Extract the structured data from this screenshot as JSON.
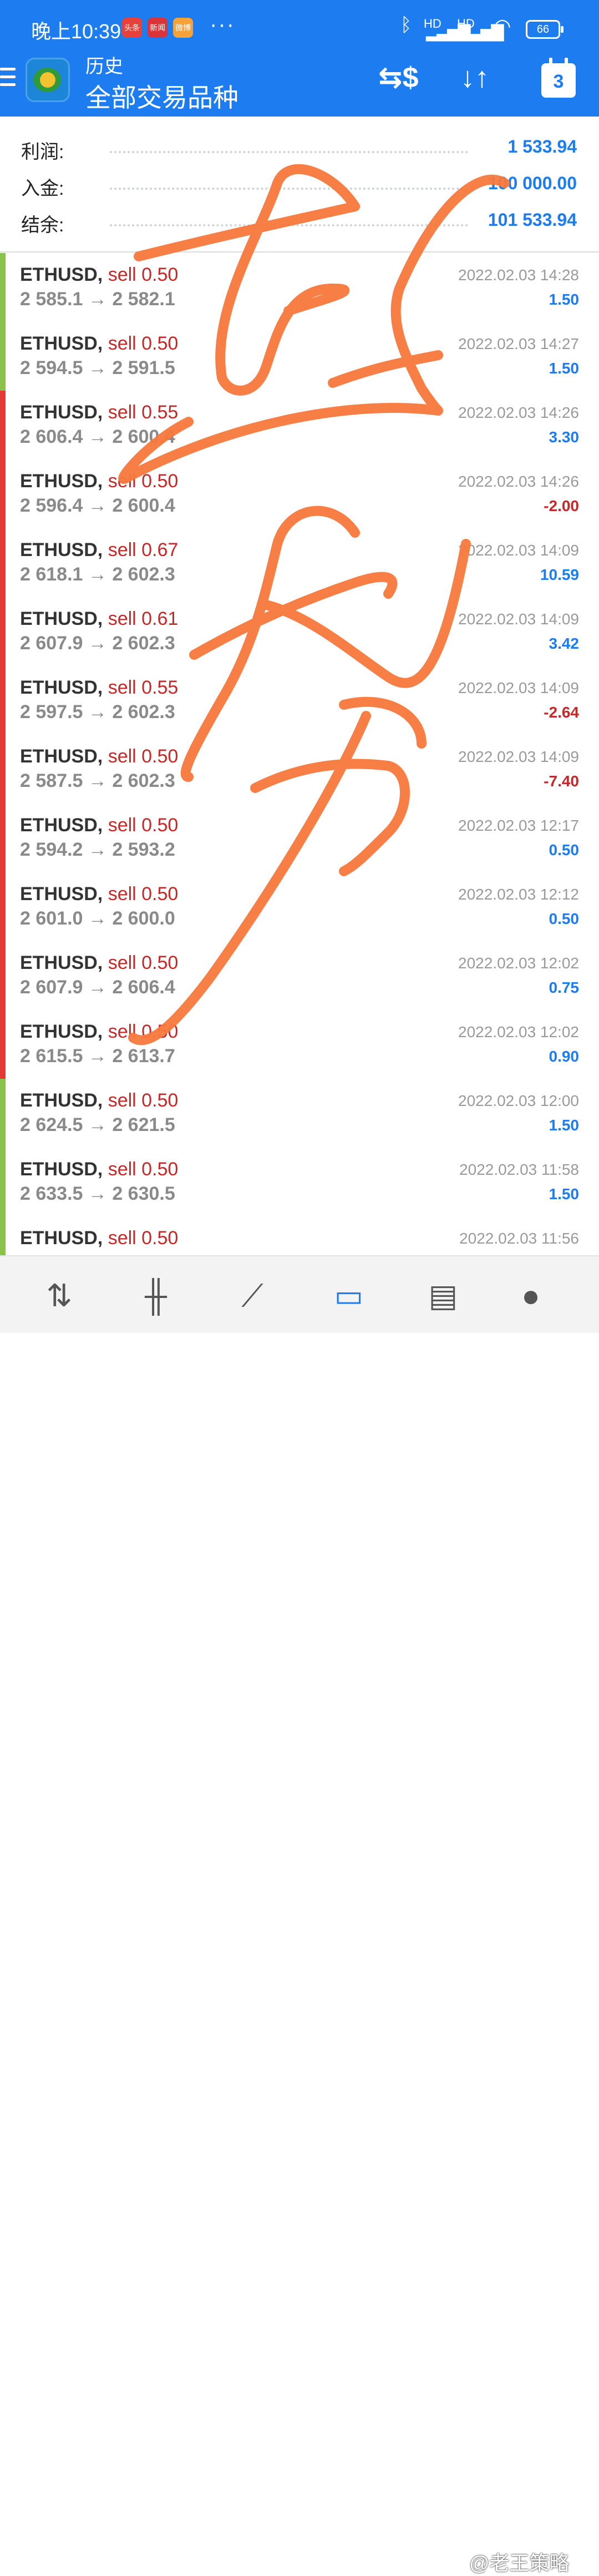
{
  "status_bar": {
    "time": "晚上10:39",
    "app_icons": [
      "头条",
      "新闻",
      "微博"
    ],
    "more": "···",
    "network_1": "HD",
    "network_2": "HD",
    "battery": "66"
  },
  "header": {
    "title": "历史",
    "subtitle": "全部交易品种",
    "calendar_day": "3",
    "icons": [
      "menu-icon",
      "app-logo-icon",
      "currency-swap-icon",
      "sort-icon",
      "calendar-icon"
    ]
  },
  "summary": {
    "profit_label": "利润:",
    "profit_value": "1 533.94",
    "deposit_label": "入金:",
    "deposit_value": "100 000.00",
    "balance_label": "结余:",
    "balance_value": "101 533.94"
  },
  "trades": [
    {
      "symbol": "ETHUSD,",
      "side": "sell 0.50",
      "prices": "2 585.1 → 2 582.1",
      "date": "2022.02.03 14:28",
      "pl": "1.50",
      "bar_color": "#8bc34a"
    },
    {
      "symbol": "ETHUSD,",
      "side": "sell 0.50",
      "prices": "2 594.5 → 2 591.5",
      "date": "2022.02.03 14:27",
      "pl": "1.50",
      "bar_color": "#8bc34a"
    },
    {
      "symbol": "ETHUSD,",
      "side": "sell 0.55",
      "prices": "2 606.4 → 2 600.4",
      "date": "2022.02.03 14:26",
      "pl": "3.30",
      "bar_color": "#e53935"
    },
    {
      "symbol": "ETHUSD,",
      "side": "sell 0.50",
      "prices": "2 596.4 → 2 600.4",
      "date": "2022.02.03 14:26",
      "pl": "-2.00",
      "bar_color": "#e53935"
    },
    {
      "symbol": "ETHUSD,",
      "side": "sell 0.67",
      "prices": "2 618.1 → 2 602.3",
      "date": "2022.02.03 14:09",
      "pl": "10.59",
      "bar_color": "#e53935"
    },
    {
      "symbol": "ETHUSD,",
      "side": "sell 0.61",
      "prices": "2 607.9 → 2 602.3",
      "date": "2022.02.03 14:09",
      "pl": "3.42",
      "bar_color": "#e53935"
    },
    {
      "symbol": "ETHUSD,",
      "side": "sell 0.55",
      "prices": "2 597.5 → 2 602.3",
      "date": "2022.02.03 14:09",
      "pl": "-2.64",
      "bar_color": "#e53935"
    },
    {
      "symbol": "ETHUSD,",
      "side": "sell 0.50",
      "prices": "2 587.5 → 2 602.3",
      "date": "2022.02.03 14:09",
      "pl": "-7.40",
      "bar_color": "#e53935"
    },
    {
      "symbol": "ETHUSD,",
      "side": "sell 0.50",
      "prices": "2 594.2 → 2 593.2",
      "date": "2022.02.03 12:17",
      "pl": "0.50",
      "bar_color": "#e53935"
    },
    {
      "symbol": "ETHUSD,",
      "side": "sell 0.50",
      "prices": "2 601.0 → 2 600.0",
      "date": "2022.02.03 12:12",
      "pl": "0.50",
      "bar_color": "#e53935"
    },
    {
      "symbol": "ETHUSD,",
      "side": "sell 0.50",
      "prices": "2 607.9 → 2 606.4",
      "date": "2022.02.03 12:02",
      "pl": "0.75",
      "bar_color": "#e53935"
    },
    {
      "symbol": "ETHUSD,",
      "side": "sell 0.50",
      "prices": "2 615.5 → 2 613.7",
      "date": "2022.02.03 12:02",
      "pl": "0.90",
      "bar_color": "#e53935"
    },
    {
      "symbol": "ETHUSD,",
      "side": "sell 0.50",
      "prices": "2 624.5 → 2 621.5",
      "date": "2022.02.03 12:00",
      "pl": "1.50",
      "bar_color": "#8bc34a"
    },
    {
      "symbol": "ETHUSD,",
      "side": "sell 0.50",
      "prices": "2 633.5 → 2 630.5",
      "date": "2022.02.03 11:58",
      "pl": "1.50",
      "bar_color": "#8bc34a"
    },
    {
      "symbol": "ETHUSD,",
      "side": "sell 0.50",
      "prices": "",
      "date": "2022.02.03 11:56",
      "pl": "",
      "bar_color": "#8bc34a"
    }
  ],
  "bottom_nav": {
    "items": [
      {
        "icon": "quotes-icon",
        "active": false
      },
      {
        "icon": "chart-icon",
        "active": false
      },
      {
        "icon": "trade-icon",
        "active": false
      },
      {
        "icon": "history-icon",
        "active": true
      },
      {
        "icon": "news-icon",
        "active": false
      },
      {
        "icon": "chat-icon",
        "active": false
      }
    ]
  },
  "watermark": "@老王策略",
  "colors": {
    "header_blue": "#1c7cf0",
    "profit_blue": "#1c7cf0",
    "loss_red": "#c62828",
    "annotation_orange": "#f7793d"
  }
}
